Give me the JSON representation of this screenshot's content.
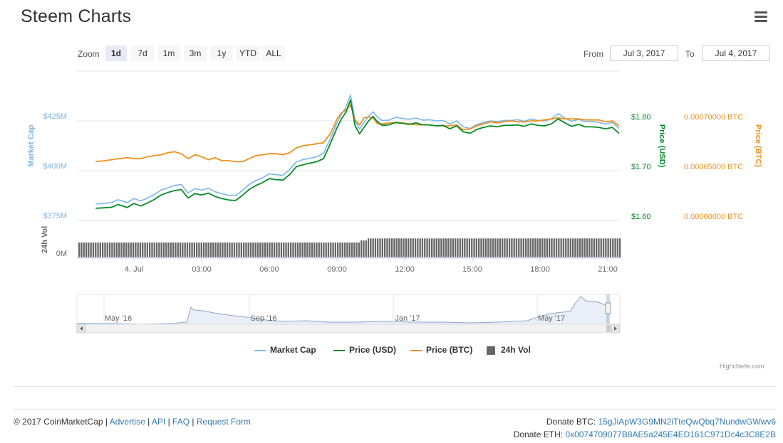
{
  "header": {
    "title": "Steem Charts"
  },
  "zoom": {
    "label": "Zoom",
    "buttons": [
      "1d",
      "7d",
      "1m",
      "3m",
      "1y",
      "YTD",
      "ALL"
    ],
    "active": "1d"
  },
  "range": {
    "from_label": "From",
    "from_value": "Jul 3, 2017",
    "to_label": "To",
    "to_value": "Jul 4, 2017"
  },
  "chart_data": {
    "type": "line",
    "x_ticks": [
      "4. Jul",
      "03:00",
      "06:00",
      "09:00",
      "12:00",
      "15:00",
      "18:00",
      "21:00"
    ],
    "y_axes": {
      "market_cap": {
        "label": "Market Cap",
        "ticks": [
          "$425M",
          "$400M",
          "$375M"
        ],
        "range": [
          375,
          425
        ]
      },
      "price_usd": {
        "label": "Price (USD)",
        "ticks": [
          "$1.80",
          "$1.70",
          "$1.60"
        ],
        "range": [
          1.6,
          1.8
        ]
      },
      "price_btc": {
        "label": "Price (BTC)",
        "ticks": [
          "0.00070000 BTC",
          "0.00065000 BTC",
          "0.00060000 BTC"
        ],
        "range": [
          0.0006,
          0.0007
        ]
      },
      "volume": {
        "label": "24h Vol",
        "ticks": [
          "0M"
        ]
      }
    },
    "x_hours": [
      -1.7,
      -1.3,
      -1,
      -0.7,
      -0.3,
      0,
      0.3,
      0.6,
      0.9,
      1.2,
      1.5,
      1.8,
      2.1,
      2.4,
      2.7,
      3,
      3.3,
      3.6,
      3.9,
      4.2,
      4.5,
      4.8,
      5.1,
      5.4,
      5.7,
      6,
      6.3,
      6.6,
      6.9,
      7.2,
      7.5,
      7.8,
      8.1,
      8.4,
      8.7,
      8.85,
      9,
      9.2,
      9.4,
      9.6,
      9.8,
      10,
      10.2,
      10.4,
      10.6,
      10.8,
      11,
      11.3,
      11.6,
      11.9,
      12.2,
      12.5,
      12.8,
      13.1,
      13.4,
      13.7,
      14,
      14.3,
      14.6,
      14.9,
      15.2,
      15.5,
      15.8,
      16.1,
      16.4,
      16.7,
      17,
      17.3,
      17.6,
      17.9,
      18.2,
      18.5,
      18.8,
      19.1,
      19.4,
      19.7,
      20,
      20.3,
      20.6,
      20.9,
      21.2,
      21.5
    ],
    "series": [
      {
        "name": "Market Cap",
        "color": "#7cb5ec",
        "values": [
          383.2,
          383.6,
          384,
          385.4,
          384,
          386,
          384.8,
          386.2,
          388,
          390.2,
          391.4,
          392.6,
          393,
          388.8,
          391,
          390.2,
          391.2,
          389.4,
          388.4,
          387.6,
          387.4,
          390,
          393,
          395,
          396.4,
          398.4,
          398,
          397.6,
          400.6,
          404.4,
          405.6,
          406.2,
          407,
          408.6,
          416,
          420,
          424,
          428.4,
          432,
          438,
          425,
          421,
          424.2,
          427.4,
          429.6,
          426.8,
          425.2,
          425.4,
          426.8,
          426.2,
          425.8,
          426.4,
          425.4,
          425.6,
          425,
          425.2,
          423.4,
          425,
          422,
          421.2,
          423.2,
          424.2,
          425,
          424.6,
          425.2,
          425.2,
          425.6,
          424.8,
          426,
          425.2,
          425,
          426,
          428.6,
          426.4,
          424.8,
          425.8,
          424.6,
          424.6,
          424.2,
          423.4,
          424.2,
          421.2
        ]
      },
      {
        "name": "Price (USD)",
        "color": "#058b29",
        "values": [
          1.6245,
          1.6255,
          1.6265,
          1.632,
          1.626,
          1.634,
          1.629,
          1.635,
          1.642,
          1.651,
          1.656,
          1.66,
          1.662,
          1.645,
          1.654,
          1.651,
          1.655,
          1.648,
          1.644,
          1.641,
          1.64,
          1.65,
          1.662,
          1.67,
          1.676,
          1.684,
          1.682,
          1.681,
          1.692,
          1.708,
          1.712,
          1.715,
          1.718,
          1.724,
          1.754,
          1.77,
          1.786,
          1.804,
          1.818,
          1.842,
          1.79,
          1.774,
          1.787,
          1.8,
          1.809,
          1.798,
          1.791,
          1.792,
          1.797,
          1.795,
          1.793,
          1.796,
          1.792,
          1.792,
          1.79,
          1.791,
          1.784,
          1.79,
          1.778,
          1.775,
          1.783,
          1.787,
          1.79,
          1.788,
          1.791,
          1.791,
          1.792,
          1.789,
          1.794,
          1.791,
          1.79,
          1.794,
          1.804,
          1.796,
          1.789,
          1.793,
          1.788,
          1.788,
          1.787,
          1.784,
          1.787,
          1.775
        ]
      },
      {
        "name": "Price (BTC)",
        "color": "#f28f1c",
        "values": [
          0.000659,
          0.00066,
          0.000661,
          0.000662,
          0.000663,
          0.000662,
          0.000662,
          0.000664,
          0.000665,
          0.000666,
          0.000668,
          0.000669,
          0.000667,
          0.000662,
          0.000666,
          0.000664,
          0.000661,
          0.000663,
          0.00066,
          0.00066,
          0.000659,
          0.000659,
          0.000662,
          0.000665,
          0.000666,
          0.000667,
          0.000667,
          0.000666,
          0.000668,
          0.000673,
          0.000675,
          0.000676,
          0.000677,
          0.000678,
          0.000687,
          0.000694,
          0.000702,
          0.000708,
          0.000711,
          0.000716,
          0.000701,
          0.000696,
          0.000703,
          0.000704,
          0.000703,
          0.000697,
          0.000697,
          0.000698,
          0.000698,
          0.000698,
          0.000697,
          0.000696,
          0.000696,
          0.000696,
          0.000695,
          0.000695,
          0.000695,
          0.000696,
          0.000691,
          0.000692,
          0.000695,
          0.000697,
          0.000699,
          0.000698,
          0.000699,
          0.0007,
          0.000699,
          0.000699,
          0.0007,
          0.0007,
          0.000701,
          0.000702,
          0.000703,
          0.000702,
          0.000702,
          0.000702,
          0.000701,
          0.000701,
          0.000701,
          0.000699,
          0.0007,
          0.000695
        ]
      },
      {
        "name": "24h Vol",
        "color": "#666666",
        "type": "column",
        "values_relative": {
          "before_0845": 0.72,
          "after_1030": 0.92
        }
      }
    ],
    "navigator": {
      "x_ticks": [
        "May '16",
        "Sep '16",
        "Jan '17",
        "May '17"
      ]
    },
    "legend_position": "bottom-center"
  },
  "legend": {
    "items": [
      {
        "label": "Market Cap",
        "color": "#7cb5ec",
        "kind": "line"
      },
      {
        "label": "Price (USD)",
        "color": "#058b29",
        "kind": "line"
      },
      {
        "label": "Price (BTC)",
        "color": "#f28f1c",
        "kind": "line"
      },
      {
        "label": "24h Vol",
        "color": "#666666",
        "kind": "box"
      }
    ]
  },
  "credits": "Highcharts.com",
  "footer": {
    "copyright": "© 2017 CoinMarketCap",
    "sep": "|",
    "links": [
      "Advertise",
      "API",
      "FAQ",
      "Request Form"
    ],
    "donate_btc_label": "Donate BTC:",
    "donate_btc_address": "15gJiApW3G9MN2iTteQwQbq7NundwGWwv6",
    "donate_eth_label": "Donate ETH:",
    "donate_eth_address": "0x0074709077B8AE5a245E4ED161C971Dc4c3C8E2B"
  }
}
